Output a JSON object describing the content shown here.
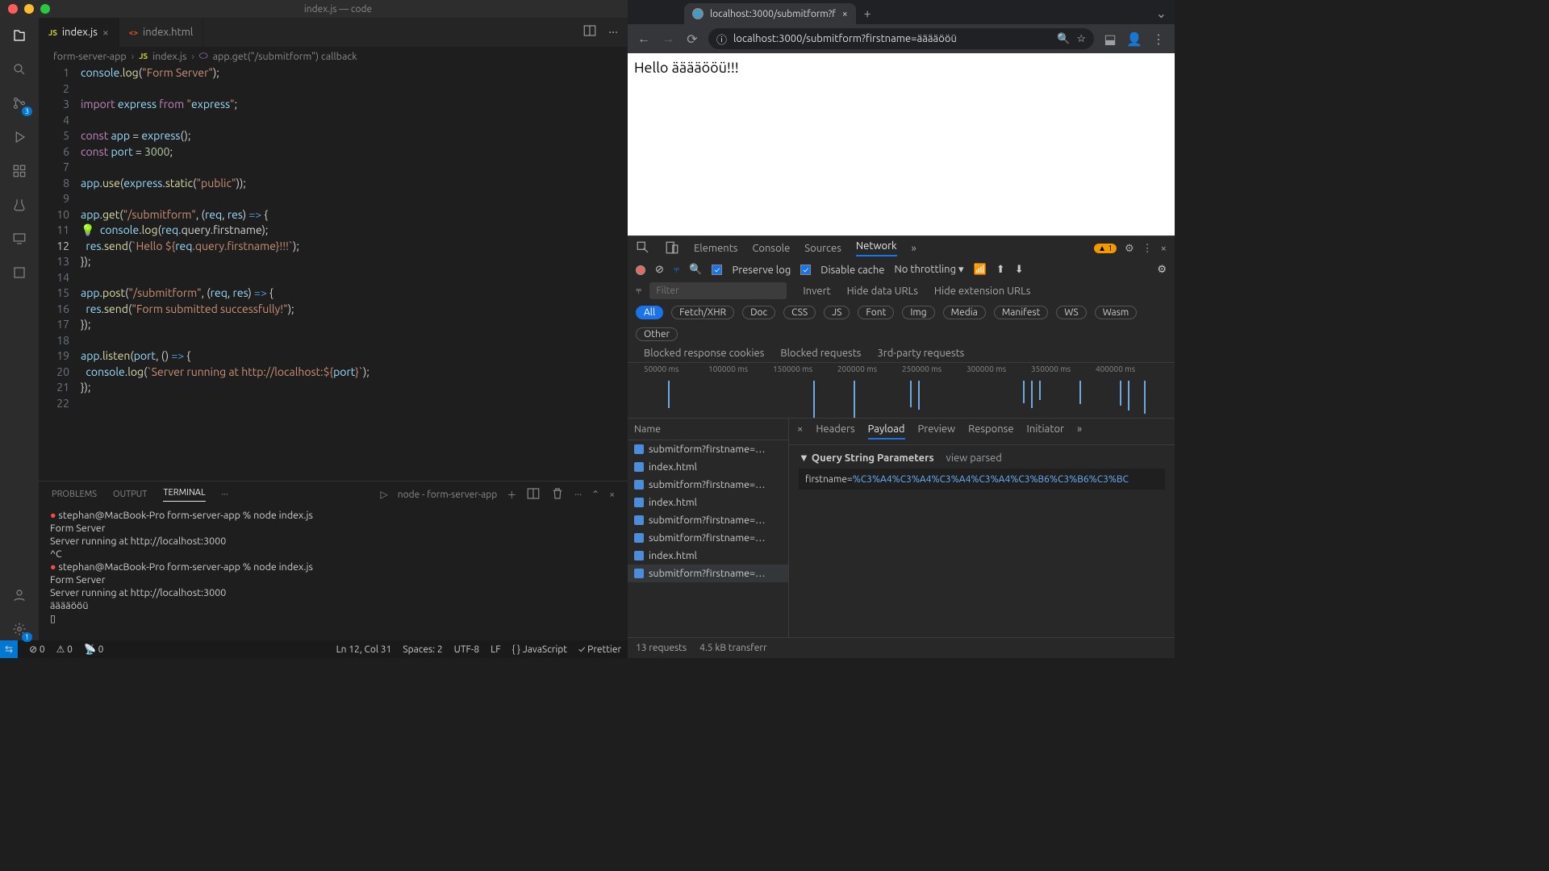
{
  "vscode": {
    "title": "index.js — code",
    "activity_badge_scm": "3",
    "activity_badge_settings": "1",
    "tabs": [
      {
        "label": "index.js",
        "icon": "JS",
        "active": true
      },
      {
        "label": "index.html",
        "icon": "<>",
        "active": false
      }
    ],
    "breadcrumb": {
      "folder": "form-server-app",
      "file": "index.js",
      "symbol": "app.get(\"/submitform\") callback"
    },
    "code": {
      "lines": [
        "console.log(\"Form Server\");",
        "",
        "import express from \"express\";",
        "",
        "const app = express();",
        "const port = 3000;",
        "",
        "app.use(express.static(\"public\"));",
        "",
        "app.get(\"/submitform\", (req, res) => {",
        "  console.log(req.query.firstname);",
        "  res.send(`Hello ${req.query.firstname}!!!`);",
        "});",
        "",
        "app.post(\"/submitform\", (req, res) => {",
        "  res.send(\"Form submitted successfully!\");",
        "});",
        "",
        "app.listen(port, () => {",
        "  console.log(`Server running at http://localhost:${port}`);",
        "});",
        ""
      ],
      "current_line": 12
    },
    "panel": {
      "tabs": [
        "PROBLEMS",
        "OUTPUT",
        "TERMINAL",
        "···"
      ],
      "active": "TERMINAL",
      "task_label": "node - form-server-app",
      "terminal_lines": [
        "stephan@MacBook-Pro form-server-app % node index.js",
        "Form Server",
        "Server running at http://localhost:3000",
        "^C",
        "stephan@MacBook-Pro form-server-app % node index.js",
        "Form Server",
        "Server running at http://localhost:3000",
        "ääääööü",
        "▯"
      ]
    },
    "status": {
      "errors": "0",
      "warnings": "0",
      "ports": "0",
      "cursor": "Ln 12, Col 31",
      "spaces": "Spaces: 2",
      "enc": "UTF-8",
      "eol": "LF",
      "lang": "JavaScript",
      "prettier": "Prettier"
    }
  },
  "chrome": {
    "tab_title": "localhost:3000/submitform?f",
    "url": "localhost:3000/submitform?firstname=ääääööü",
    "page_text": "Hello ääääööü!!!",
    "devtools": {
      "tabs": [
        "Elements",
        "Console",
        "Sources",
        "Network"
      ],
      "active": "Network",
      "issue_count": "1",
      "toolbar": {
        "preserve_log": "Preserve log",
        "disable_cache": "Disable cache",
        "throttling": "No throttling"
      },
      "filter_placeholder": "Filter",
      "filter_opts": [
        "Invert",
        "Hide data URLs",
        "Hide extension URLs"
      ],
      "type_pills": [
        "All",
        "Fetch/XHR",
        "Doc",
        "CSS",
        "JS",
        "Font",
        "Img",
        "Media",
        "Manifest",
        "WS",
        "Wasm",
        "Other"
      ],
      "block_opts": [
        "Blocked response cookies",
        "Blocked requests",
        "3rd-party requests"
      ],
      "timeline_ticks": [
        "50000 ms",
        "100000 ms",
        "150000 ms",
        "200000 ms",
        "250000 ms",
        "300000 ms",
        "350000 ms",
        "400000 ms"
      ],
      "reqlist_header": "Name",
      "requests": [
        "submitform?firstname=…",
        "index.html",
        "submitform?firstname=…",
        "index.html",
        "submitform?firstname=…",
        "submitform?firstname=…",
        "index.html",
        "submitform?firstname=…"
      ],
      "detail_tabs": [
        "Headers",
        "Payload",
        "Preview",
        "Response",
        "Initiator"
      ],
      "detail_active": "Payload",
      "section_title": "Query String Parameters",
      "section_link": "view parsed",
      "payload_key": "firstname=",
      "payload_val": "%C3%A4%C3%A4%C3%A4%C3%A4%C3%B6%C3%B6%C3%BC",
      "status": {
        "reqs": "13 requests",
        "xfer": "4.5 kB transferr"
      }
    }
  }
}
